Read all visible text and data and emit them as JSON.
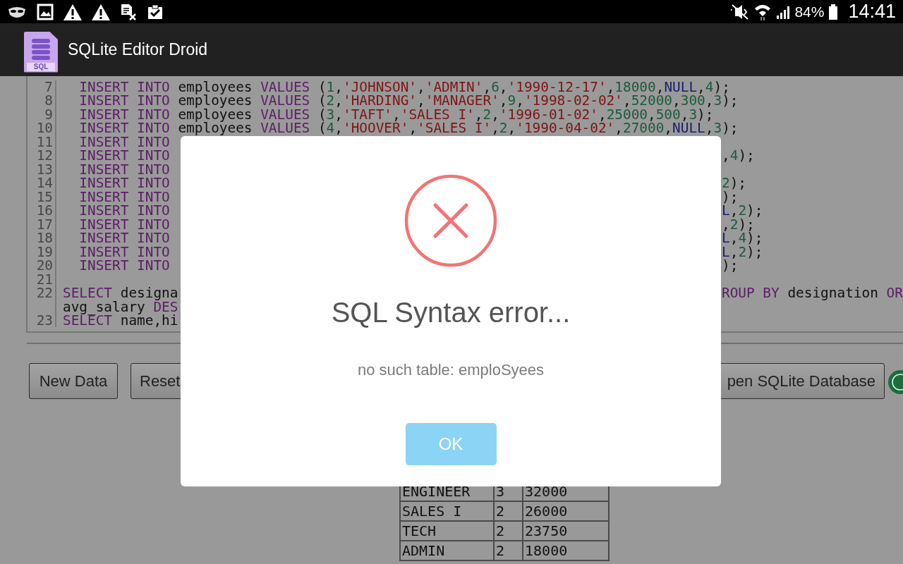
{
  "status_bar": {
    "battery_percent": "84%",
    "time": "14:41"
  },
  "app_bar": {
    "icon_label": "SQL",
    "title": "SQLite Editor Droid"
  },
  "editor": {
    "lines": [
      {
        "number": "7",
        "code": [
          {
            "kind": "kw",
            "text": "  INSERT INTO"
          },
          {
            "kind": "plain",
            "text": " employees "
          },
          {
            "kind": "kw",
            "text": "VALUES"
          },
          {
            "kind": "plain",
            "text": " ("
          },
          {
            "kind": "num",
            "text": "1"
          },
          {
            "kind": "plain",
            "text": ","
          },
          {
            "kind": "str",
            "text": "'JOHNSON'"
          },
          {
            "kind": "plain",
            "text": ","
          },
          {
            "kind": "str",
            "text": "'ADMIN'"
          },
          {
            "kind": "plain",
            "text": ","
          },
          {
            "kind": "num",
            "text": "6"
          },
          {
            "kind": "plain",
            "text": ","
          },
          {
            "kind": "str",
            "text": "'1990-12-17'"
          },
          {
            "kind": "plain",
            "text": ","
          },
          {
            "kind": "num",
            "text": "18000"
          },
          {
            "kind": "plain",
            "text": ","
          },
          {
            "kind": "null",
            "text": "NULL"
          },
          {
            "kind": "plain",
            "text": ","
          },
          {
            "kind": "num",
            "text": "4"
          },
          {
            "kind": "plain",
            "text": ");"
          }
        ]
      },
      {
        "number": "8",
        "code": [
          {
            "kind": "kw",
            "text": "  INSERT INTO"
          },
          {
            "kind": "plain",
            "text": " employees "
          },
          {
            "kind": "kw",
            "text": "VALUES"
          },
          {
            "kind": "plain",
            "text": " ("
          },
          {
            "kind": "num",
            "text": "2"
          },
          {
            "kind": "plain",
            "text": ","
          },
          {
            "kind": "str",
            "text": "'HARDING'"
          },
          {
            "kind": "plain",
            "text": ","
          },
          {
            "kind": "str",
            "text": "'MANAGER'"
          },
          {
            "kind": "plain",
            "text": ","
          },
          {
            "kind": "num",
            "text": "9"
          },
          {
            "kind": "plain",
            "text": ","
          },
          {
            "kind": "str",
            "text": "'1998-02-02'"
          },
          {
            "kind": "plain",
            "text": ","
          },
          {
            "kind": "num",
            "text": "52000"
          },
          {
            "kind": "plain",
            "text": ","
          },
          {
            "kind": "num",
            "text": "300"
          },
          {
            "kind": "plain",
            "text": ","
          },
          {
            "kind": "num",
            "text": "3"
          },
          {
            "kind": "plain",
            "text": ");"
          }
        ]
      },
      {
        "number": "9",
        "code": [
          {
            "kind": "kw",
            "text": "  INSERT INTO"
          },
          {
            "kind": "plain",
            "text": " employees "
          },
          {
            "kind": "kw",
            "text": "VALUES"
          },
          {
            "kind": "plain",
            "text": " ("
          },
          {
            "kind": "num",
            "text": "3"
          },
          {
            "kind": "plain",
            "text": ","
          },
          {
            "kind": "str",
            "text": "'TAFT'"
          },
          {
            "kind": "plain",
            "text": ","
          },
          {
            "kind": "str",
            "text": "'SALES I'"
          },
          {
            "kind": "plain",
            "text": ","
          },
          {
            "kind": "num",
            "text": "2"
          },
          {
            "kind": "plain",
            "text": ","
          },
          {
            "kind": "str",
            "text": "'1996-01-02'"
          },
          {
            "kind": "plain",
            "text": ","
          },
          {
            "kind": "num",
            "text": "25000"
          },
          {
            "kind": "plain",
            "text": ","
          },
          {
            "kind": "num",
            "text": "500"
          },
          {
            "kind": "plain",
            "text": ","
          },
          {
            "kind": "num",
            "text": "3"
          },
          {
            "kind": "plain",
            "text": ");"
          }
        ]
      },
      {
        "number": "10",
        "code": [
          {
            "kind": "kw",
            "text": "  INSERT INTO"
          },
          {
            "kind": "plain",
            "text": " employees "
          },
          {
            "kind": "kw",
            "text": "VALUES"
          },
          {
            "kind": "plain",
            "text": " ("
          },
          {
            "kind": "num",
            "text": "4"
          },
          {
            "kind": "plain",
            "text": ","
          },
          {
            "kind": "str",
            "text": "'HOOVER'"
          },
          {
            "kind": "plain",
            "text": ","
          },
          {
            "kind": "str",
            "text": "'SALES I'"
          },
          {
            "kind": "plain",
            "text": ","
          },
          {
            "kind": "num",
            "text": "2"
          },
          {
            "kind": "plain",
            "text": ","
          },
          {
            "kind": "str",
            "text": "'1990-04-02'"
          },
          {
            "kind": "plain",
            "text": ","
          },
          {
            "kind": "num",
            "text": "27000"
          },
          {
            "kind": "plain",
            "text": ","
          },
          {
            "kind": "null",
            "text": "NULL"
          },
          {
            "kind": "plain",
            "text": ","
          },
          {
            "kind": "num",
            "text": "3"
          },
          {
            "kind": "plain",
            "text": ");"
          }
        ]
      },
      {
        "number": "11",
        "code": [
          {
            "kind": "kw",
            "text": "  INSERT INTO"
          }
        ]
      },
      {
        "number": "12",
        "code": [
          {
            "kind": "kw",
            "text": "  INSERT INTO"
          }
        ],
        "tail": [
          {
            "kind": "plain",
            "text": ","
          },
          {
            "kind": "num",
            "text": "4"
          },
          {
            "kind": "plain",
            "text": ");"
          }
        ]
      },
      {
        "number": "13",
        "code": [
          {
            "kind": "kw",
            "text": "  INSERT INTO"
          }
        ]
      },
      {
        "number": "14",
        "code": [
          {
            "kind": "kw",
            "text": "  INSERT INTO"
          }
        ],
        "tail": [
          {
            "kind": "num",
            "text": "2"
          },
          {
            "kind": "plain",
            "text": ");"
          }
        ]
      },
      {
        "number": "15",
        "code": [
          {
            "kind": "kw",
            "text": "  INSERT INTO"
          }
        ],
        "tail": [
          {
            "kind": "plain",
            "text": ");"
          }
        ]
      },
      {
        "number": "16",
        "code": [
          {
            "kind": "kw",
            "text": "  INSERT INTO"
          }
        ],
        "tail": [
          {
            "kind": "null",
            "text": "L"
          },
          {
            "kind": "plain",
            "text": ","
          },
          {
            "kind": "num",
            "text": "2"
          },
          {
            "kind": "plain",
            "text": ");"
          }
        ]
      },
      {
        "number": "17",
        "code": [
          {
            "kind": "kw",
            "text": "  INSERT INTO"
          }
        ],
        "tail": [
          {
            "kind": "plain",
            "text": ","
          },
          {
            "kind": "num",
            "text": "2"
          },
          {
            "kind": "plain",
            "text": ");"
          }
        ]
      },
      {
        "number": "18",
        "code": [
          {
            "kind": "kw",
            "text": "  INSERT INTO"
          }
        ],
        "tail": [
          {
            "kind": "null",
            "text": "L"
          },
          {
            "kind": "plain",
            "text": ","
          },
          {
            "kind": "num",
            "text": "4"
          },
          {
            "kind": "plain",
            "text": ");"
          }
        ]
      },
      {
        "number": "19",
        "code": [
          {
            "kind": "kw",
            "text": "  INSERT INTO"
          }
        ],
        "tail": [
          {
            "kind": "null",
            "text": "L"
          },
          {
            "kind": "plain",
            "text": ","
          },
          {
            "kind": "num",
            "text": "2"
          },
          {
            "kind": "plain",
            "text": ");"
          }
        ]
      },
      {
        "number": "20",
        "code": [
          {
            "kind": "kw",
            "text": "  INSERT INTO"
          }
        ],
        "tail": [
          {
            "kind": "plain",
            "text": ");"
          }
        ]
      },
      {
        "number": "21"
      },
      {
        "number": "22",
        "code": [
          {
            "kind": "kw",
            "text": "SELECT"
          },
          {
            "kind": "plain",
            "text": " designa"
          }
        ],
        "tail": [
          {
            "kind": "kw",
            "text": "ROUP BY"
          },
          {
            "kind": "plain",
            "text": " designation "
          },
          {
            "kind": "kw",
            "text": "OR"
          }
        ]
      },
      {
        "code": [
          {
            "kind": "plain",
            "text": "avg_salary "
          },
          {
            "kind": "kw",
            "text": "DES"
          }
        ]
      },
      {
        "number": "23",
        "code": [
          {
            "kind": "kw",
            "text": "SELECT"
          },
          {
            "kind": "plain",
            "text": " name,hi"
          }
        ]
      }
    ]
  },
  "buttons": [
    {
      "label": "New Data"
    },
    {
      "label": "Reset"
    },
    {
      "label": "pen SQLite Database"
    }
  ],
  "result_table": {
    "rows": [
      [
        "ENGINEER",
        "3",
        "32000"
      ],
      [
        "SALES I",
        "2",
        "26000"
      ],
      [
        "TECH",
        "2",
        "23750"
      ],
      [
        "ADMIN",
        "2",
        "18000"
      ]
    ]
  },
  "dialog": {
    "title": "SQL Syntax error...",
    "message": "no such table: emploSyees",
    "buttons": [
      {
        "label": "OK"
      }
    ]
  }
}
